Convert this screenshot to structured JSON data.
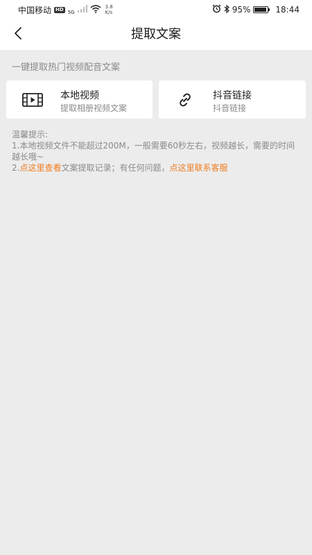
{
  "status_bar": {
    "carrier": "中国移动",
    "hd_badge": "HD",
    "network": "5G",
    "speed_value": "3.8",
    "speed_unit": "K/s",
    "battery": "95%",
    "time": "18:44"
  },
  "nav": {
    "title": "提取文案"
  },
  "subtitle": "一键提取热门视频配音文案",
  "options": [
    {
      "title": "本地视频",
      "desc": "提取相册视频文案",
      "icon": "video-film-icon"
    },
    {
      "title": "抖音链接",
      "desc": "抖音链接",
      "icon": "link-icon"
    }
  ],
  "tips": {
    "heading": "温馨提示:",
    "line1": "1.本地视频文件不能超过200M，一般需要60秒左右，视频越长，需要的时间越长哦~",
    "line2_prefix": "2.",
    "line2_link1": "点这里查看",
    "line2_middle": "文案提取记录；有任何问题，",
    "line2_link2": "点这里联系客服"
  },
  "colors": {
    "accent": "#ef7d22",
    "background": "#ececec",
    "card": "#ffffff",
    "secondary_text": "#8a8a8a"
  }
}
